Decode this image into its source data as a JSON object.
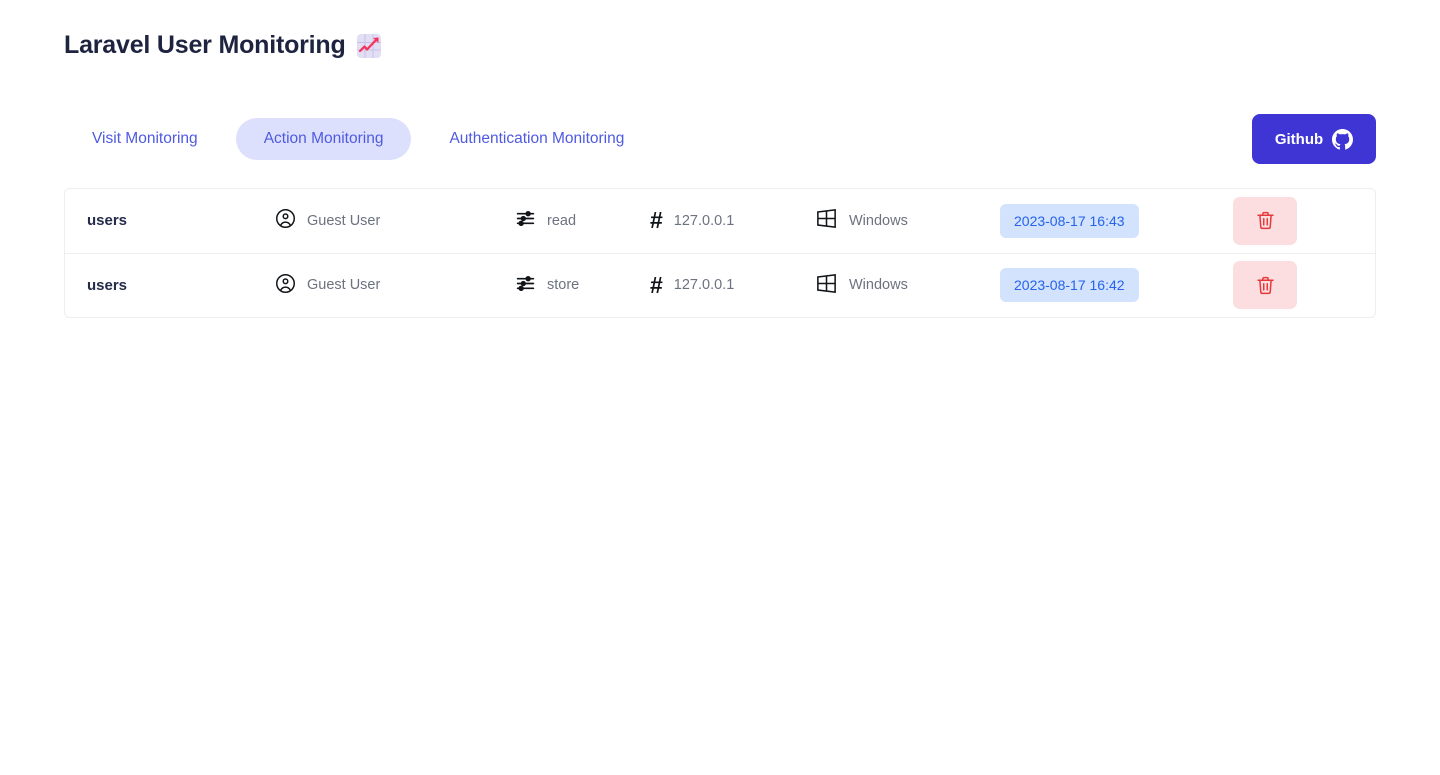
{
  "header": {
    "title": "Laravel User Monitoring",
    "emoji_icon": "chart-increasing-emoji"
  },
  "tabs": [
    {
      "label": "Visit Monitoring",
      "active": false,
      "name": "tab-visit-monitoring"
    },
    {
      "label": "Action Monitoring",
      "active": true,
      "name": "tab-action-monitoring"
    },
    {
      "label": "Authentication Monitoring",
      "active": false,
      "name": "tab-authentication-monitoring"
    }
  ],
  "github_button": {
    "label": "Github",
    "icon": "github-icon",
    "background": "#3f35d4",
    "text_color": "#ffffff"
  },
  "colors": {
    "accent": "#4f5ae0",
    "active_tab_background": "#dde0fd",
    "badge_background": "#d3e2fd",
    "badge_text": "#2563eb",
    "delete_background": "#fcdde0",
    "delete_icon": "#e5383b",
    "table_border": "#eceef1",
    "title_text": "#1e2340"
  },
  "table": {
    "rows": [
      {
        "name": "users",
        "user": "Guest User",
        "user_icon": "user-circle-icon",
        "action": "read",
        "action_icon": "sliders-icon",
        "ip": "127.0.0.1",
        "ip_icon": "hash-icon",
        "os": "Windows",
        "os_icon": "windows-icon",
        "timestamp": "2023-08-17 16:43",
        "delete_icon": "trash-icon"
      },
      {
        "name": "users",
        "user": "Guest User",
        "user_icon": "user-circle-icon",
        "action": "store",
        "action_icon": "sliders-icon",
        "ip": "127.0.0.1",
        "ip_icon": "hash-icon",
        "os": "Windows",
        "os_icon": "windows-icon",
        "timestamp": "2023-08-17 16:42",
        "delete_icon": "trash-icon"
      }
    ]
  }
}
